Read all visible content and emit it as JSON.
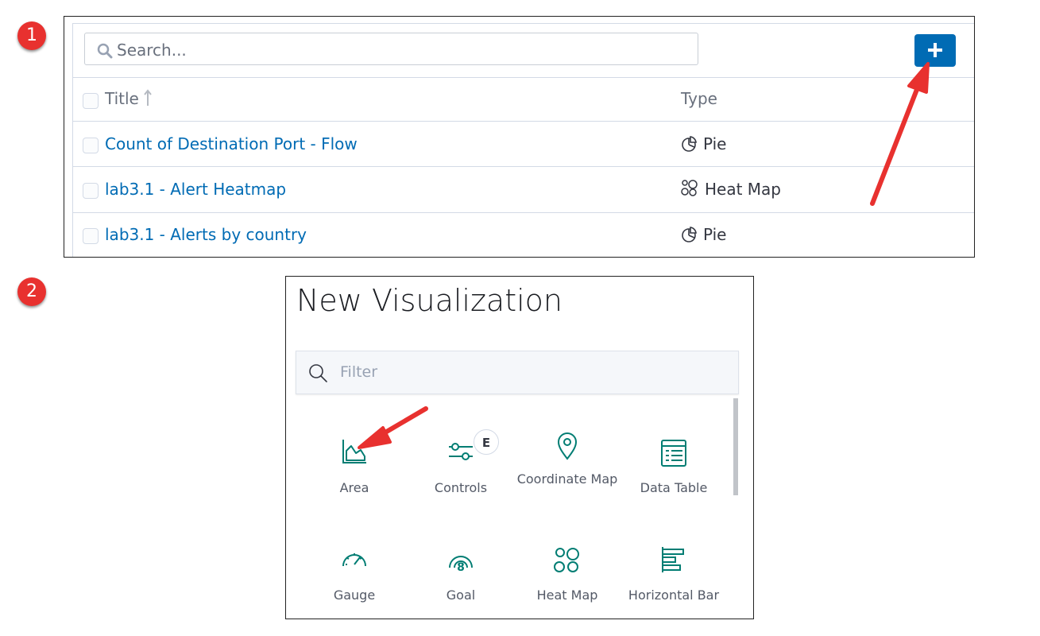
{
  "steps": [
    "1",
    "2"
  ],
  "list": {
    "search_placeholder": "Search...",
    "add_button_icon": "plus-icon",
    "columns": {
      "title": "Title",
      "type": "Type"
    },
    "rows": [
      {
        "title": "Count of Destination Port - Flow",
        "type": "Pie",
        "type_icon": "pie-icon"
      },
      {
        "title": "lab3.1 - Alert Heatmap",
        "type": "Heat Map",
        "type_icon": "heatmap-icon"
      },
      {
        "title": "lab3.1 - Alerts by country",
        "type": "Pie",
        "type_icon": "pie-icon"
      }
    ]
  },
  "modal": {
    "title": "New Visualization",
    "filter_placeholder": "Filter",
    "experimental_badge": "E",
    "tiles": [
      {
        "label": "Area",
        "icon": "area-chart-icon"
      },
      {
        "label": "Controls",
        "icon": "controls-icon"
      },
      {
        "label": "Coordinate Map",
        "icon": "map-pin-icon"
      },
      {
        "label": "Data Table",
        "icon": "table-icon"
      },
      {
        "label": "Gauge",
        "icon": "gauge-icon"
      },
      {
        "label": "Goal",
        "icon": "goal-icon"
      },
      {
        "label": "Heat Map",
        "icon": "heatmap-icon"
      },
      {
        "label": "Horizontal Bar",
        "icon": "horizontal-bar-icon"
      }
    ]
  },
  "colors": {
    "accent": "#006bb4",
    "icon_teal": "#017d73",
    "annotation_red": "#e8312f"
  }
}
